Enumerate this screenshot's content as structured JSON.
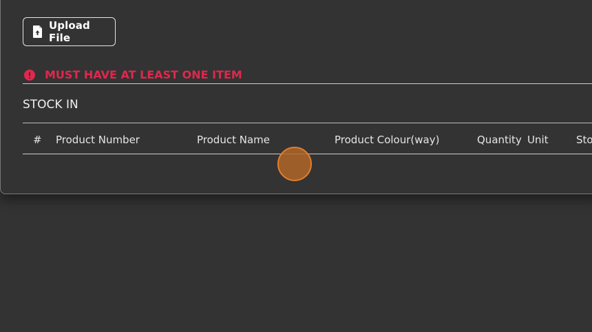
{
  "upload": {
    "label": "Upload File",
    "icon": "file-upload-icon"
  },
  "validation": {
    "message": "MUST HAVE AT LEAST ONE ITEM",
    "icon": "alert-circle-icon",
    "color": "#e0284d"
  },
  "section": {
    "title": "STOCK IN"
  },
  "table": {
    "columns": [
      "#",
      "Product Number",
      "Product Name",
      "Product Colour(way)",
      "Quantity",
      "Unit",
      "Sto"
    ]
  },
  "theme": {
    "background": "#333333",
    "text": "#e6e6e6",
    "pointer_color": "#e07f30"
  }
}
